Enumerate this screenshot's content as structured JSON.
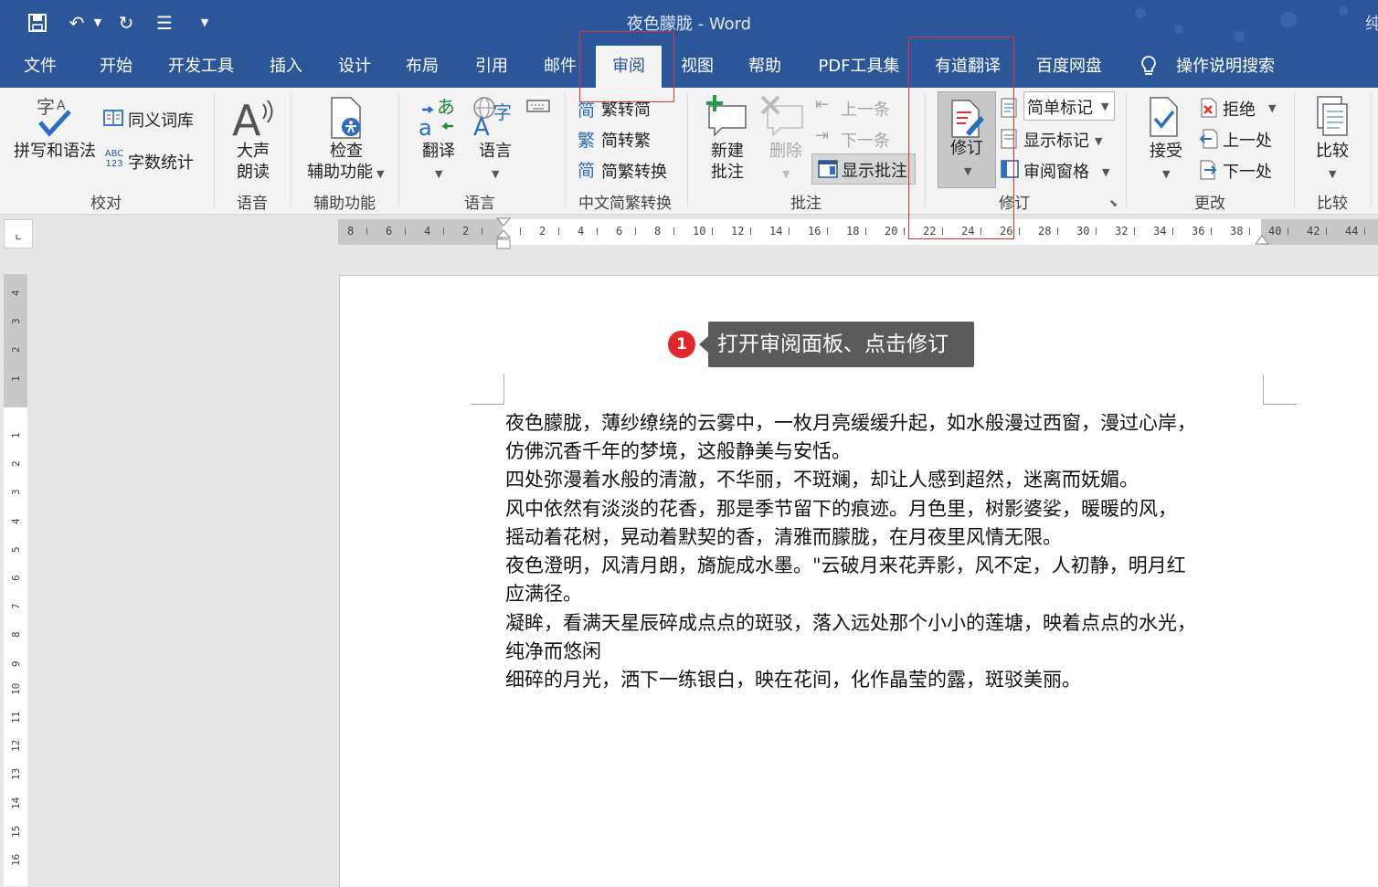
{
  "window": {
    "title": "夜色朦胧  -  Word",
    "right_fragment": "纯"
  },
  "qat": {
    "save_icon": "save-icon",
    "undo_icon": "undo-icon",
    "redo_icon": "redo-icon",
    "touch_icon": "touch-mode-icon",
    "customize_icon": "customize-icon"
  },
  "tabs": [
    "文件",
    "开始",
    "开发工具",
    "插入",
    "设计",
    "布局",
    "引用",
    "邮件",
    "审阅",
    "视图",
    "帮助",
    "PDF工具集",
    "有道翻译",
    "百度网盘"
  ],
  "active_tab": "审阅",
  "tell_me": "操作说明搜索",
  "ribbon": {
    "proofing": {
      "spelling": "拼写和语法",
      "thesaurus": "同义词库",
      "wordcount": "字数统计",
      "wordcount_icon_text": "ABC 123",
      "label": "校对"
    },
    "speech": {
      "read_aloud_1": "大声",
      "read_aloud_2": "朗读",
      "label": "语音"
    },
    "accessibility": {
      "check_1": "检查",
      "check_2": "辅助功能",
      "label": "辅助功能"
    },
    "language": {
      "translate": "翻译",
      "language": "语言",
      "label": "语言"
    },
    "chinese": {
      "to_simplified": "繁转简",
      "to_traditional": "简转繁",
      "convert": "简繁转换",
      "label": "中文简繁转换",
      "glyph_simplified": "简",
      "glyph_traditional": "繁",
      "glyph_convert": "简"
    },
    "comments": {
      "new_1": "新建",
      "new_2": "批注",
      "delete": "删除",
      "previous": "上一条",
      "next": "下一条",
      "show": "显示批注",
      "label": "批注"
    },
    "tracking": {
      "track_changes": "修订",
      "simple_markup": "简单标记",
      "show_markup": "显示标记",
      "review_pane": "审阅窗格",
      "label": "修订"
    },
    "changes": {
      "accept": "接受",
      "reject": "拒绝",
      "previous": "上一处",
      "next": "下一处",
      "label": "更改"
    },
    "compare": {
      "compare": "比较",
      "label": "比较"
    }
  },
  "hruler": {
    "ticks": [
      "8",
      "6",
      "4",
      "2",
      "",
      "2",
      "4",
      "6",
      "8",
      "10",
      "12",
      "14",
      "16",
      "18",
      "20",
      "22",
      "24",
      "26",
      "28",
      "30",
      "32",
      "34",
      "36",
      "38",
      "40",
      "42",
      "44"
    ]
  },
  "vruler": {
    "ticks": [
      "4",
      "3",
      "2",
      "1",
      "",
      "1",
      "2",
      "3",
      "4",
      "5",
      "6",
      "7",
      "8",
      "9",
      "10",
      "11",
      "12",
      "13",
      "14",
      "15",
      "16"
    ]
  },
  "annotation": {
    "step": "1",
    "text": "打开审阅面板、点击修订"
  },
  "document": {
    "lines": [
      "夜色朦胧，薄纱缭绕的云雾中，一枚月亮缓缓升起，如水般漫过西窗，漫过心岸，",
      "仿佛沉香千年的梦境，这般静美与安恬。",
      "四处弥漫着水般的清澈，不华丽，不斑斓，却让人感到超然，迷离而妩媚。",
      "风中依然有淡淡的花香，那是季节留下的痕迹。月色里，树影婆娑，暖暖的风，",
      "摇动着花树，晃动着默契的香，清雅而朦胧，在月夜里风情无限。",
      "夜色澄明，风清月朗，旖旎成水墨。\"云破月来花弄影，风不定，人初静，明月红",
      "应满径。",
      "凝眸，看满天星辰碎成点点的斑驳，落入远处那个小小的莲塘，映着点点的水光，",
      "纯净而悠闲",
      "细碎的月光，洒下一练银白，映在花间，化作晶莹的露，斑驳美丽。"
    ]
  },
  "colors": {
    "brand": "#2b579a",
    "highlight": "#e03030",
    "badge": "#e3262e"
  }
}
